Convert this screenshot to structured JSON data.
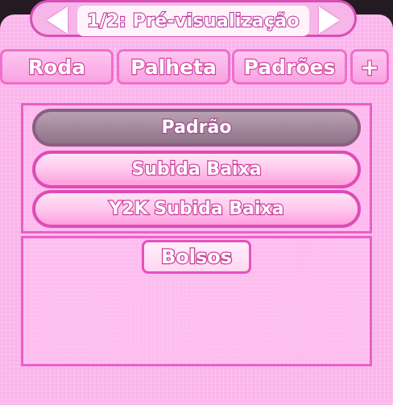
{
  "header": {
    "title": "1/2: Pré-visualização",
    "prev_icon": "arrow-left-icon",
    "next_icon": "arrow-right-icon"
  },
  "tabs": [
    {
      "label": "Roda"
    },
    {
      "label": "Palheta"
    },
    {
      "label": "Padrões"
    },
    {
      "label": "+"
    }
  ],
  "patterns": [
    {
      "label": "Padrão",
      "selected": true
    },
    {
      "label": "Subida Baixa",
      "selected": false
    },
    {
      "label": "Y2K Subida Baixa",
      "selected": false
    }
  ],
  "pockets": {
    "label": "Bolsos"
  },
  "colors": {
    "panel": "#fbb6ec",
    "accent": "#e04bb6",
    "selected": "#9a7d92"
  }
}
